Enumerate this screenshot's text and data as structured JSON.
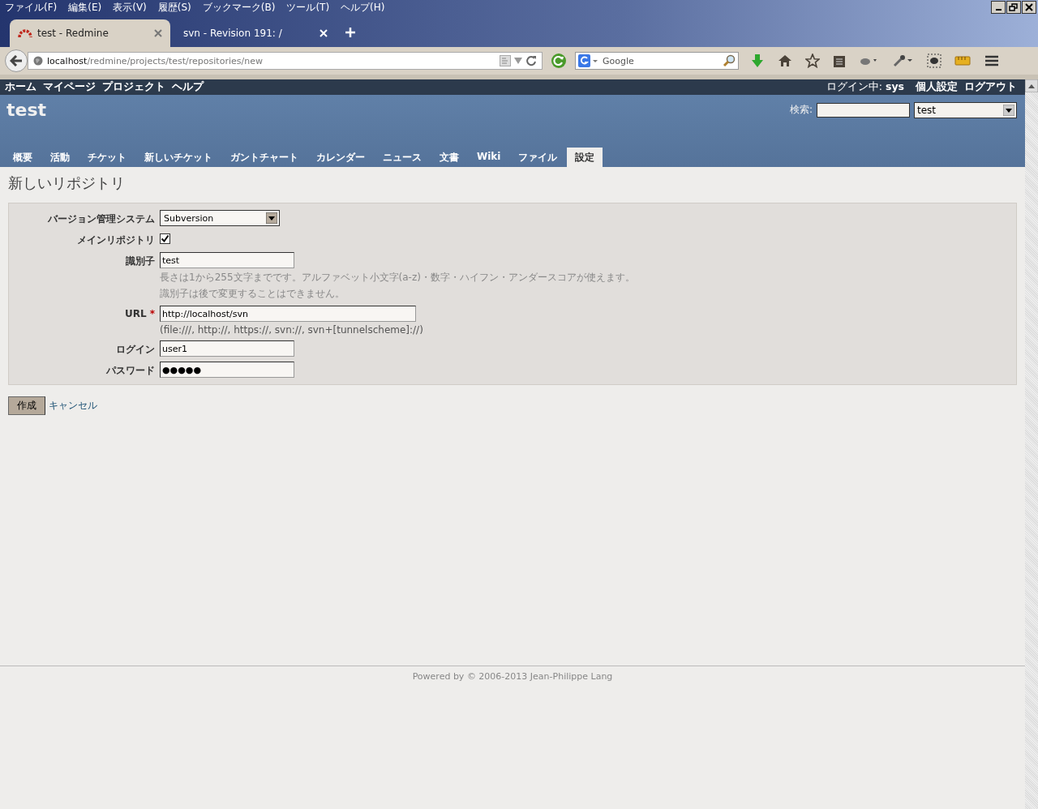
{
  "browser": {
    "menu": [
      "ファイル(F)",
      "編集(E)",
      "表示(V)",
      "履歴(S)",
      "ブックマーク(B)",
      "ツール(T)",
      "ヘルプ(H)"
    ],
    "tabs": [
      {
        "title": "test - Redmine",
        "selected": true
      },
      {
        "title": "svn - Revision 191: /",
        "selected": false
      }
    ],
    "address": {
      "host": "localhost",
      "path": "/redmine/projects/test/repositories/new"
    },
    "search": {
      "placeholder": "Google"
    }
  },
  "top_menu": {
    "left": [
      "ホーム",
      "マイページ",
      "プロジェクト",
      "ヘルプ"
    ],
    "logged_in_label": "ログイン中:",
    "user": "sys",
    "right": [
      "個人設定",
      "ログアウト"
    ]
  },
  "header": {
    "title": "test",
    "search_label": "検索:",
    "project_select": "test"
  },
  "main_menu": [
    {
      "label": "概要",
      "selected": false
    },
    {
      "label": "活動",
      "selected": false
    },
    {
      "label": "チケット",
      "selected": false
    },
    {
      "label": "新しいチケット",
      "selected": false
    },
    {
      "label": "ガントチャート",
      "selected": false
    },
    {
      "label": "カレンダー",
      "selected": false
    },
    {
      "label": "ニュース",
      "selected": false
    },
    {
      "label": "文書",
      "selected": false
    },
    {
      "label": "Wiki",
      "selected": false
    },
    {
      "label": "ファイル",
      "selected": false
    },
    {
      "label": "設定",
      "selected": true
    }
  ],
  "page_title": "新しいリポジトリ",
  "form": {
    "fields": [
      {
        "kind": "select",
        "label": "バージョン管理システム",
        "value": "Subversion"
      },
      {
        "kind": "checkbox",
        "label": "メインリポジトリ",
        "checked": true
      },
      {
        "kind": "text",
        "label": "識別子",
        "value": "test",
        "notes": [
          "長さは1から255文字までです。アルファベット小文字(a-z)・数字・ハイフン・アンダースコアが使えます。",
          "識別子は後で変更することはできません。"
        ]
      },
      {
        "kind": "url",
        "label": "URL",
        "required_mark": "*",
        "value": "http://localhost/svn",
        "hint": "(file:///, http://, https://, svn://, svn+[tunnelscheme]://)"
      },
      {
        "kind": "text",
        "label": "ログイン",
        "value": "user1"
      },
      {
        "kind": "text",
        "label": "パスワード",
        "value": "●●●●●"
      }
    ]
  },
  "buttons": {
    "submit": "作成",
    "cancel": "キャンセル"
  },
  "footer": "Powered by © 2006-2013 Jean-Philippe Lang"
}
